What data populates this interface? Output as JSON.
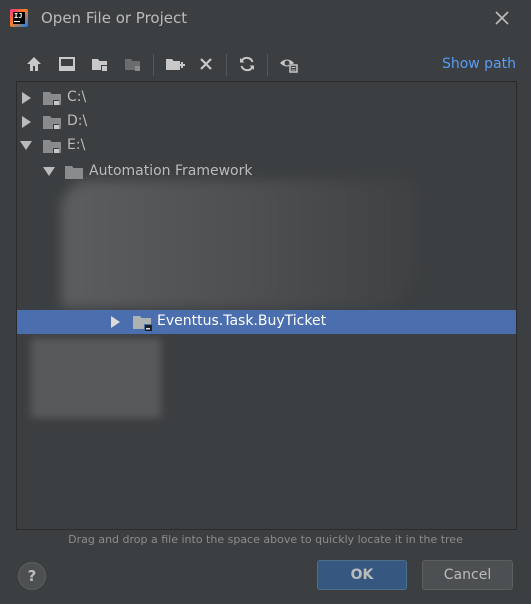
{
  "window": {
    "title": "Open File or Project",
    "app_icon_text": "IJ"
  },
  "toolbar": {
    "icons": [
      "home-icon",
      "desktop-icon",
      "project-folder-icon",
      "module-folder-icon",
      "new-folder-icon",
      "delete-icon",
      "refresh-icon",
      "show-hidden-icon"
    ],
    "show_path_label": "Show path"
  },
  "tree": {
    "rows": [
      {
        "label": "C:\\",
        "expanded": false
      },
      {
        "label": "D:\\",
        "expanded": false
      },
      {
        "label": "E:\\",
        "expanded": true
      },
      {
        "label": "Automation Framework",
        "expanded": true
      },
      {
        "label": "Eventtus.Task.BuyTicket",
        "expanded": false,
        "selected": true
      }
    ]
  },
  "hint": "Drag and drop a file into the space above to quickly locate it in the tree",
  "buttons": {
    "help": "?",
    "ok": "OK",
    "cancel": "Cancel"
  },
  "colors": {
    "background": "#3c3f41",
    "selection": "#4b6eaf",
    "link": "#589df6",
    "ok_button": "#365880"
  }
}
